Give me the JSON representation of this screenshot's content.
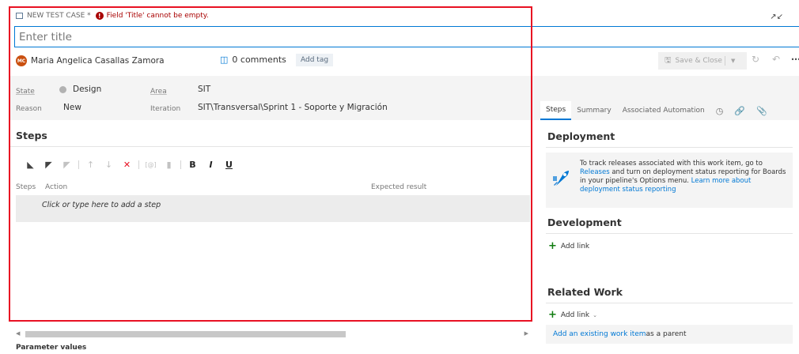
{
  "header": {
    "work_item_type": "NEW TEST CASE *",
    "error_message": "Field 'Title' cannot be empty."
  },
  "title": {
    "placeholder": "Enter title",
    "value": ""
  },
  "author": {
    "initials": "MC",
    "name": "Maria Angelica Casallas Zamora"
  },
  "comments": {
    "label": "0 comments"
  },
  "tags": {
    "add_label": "Add tag"
  },
  "actions": {
    "save_close": "Save & Close"
  },
  "fields": {
    "state_label": "State",
    "state_value": "Design",
    "reason_label": "Reason",
    "reason_value": "New",
    "area_label": "Area",
    "area_value": "SIT",
    "iteration_label": "Iteration",
    "iteration_value": "SIT\\Transversal\\Sprint 1 - Soporte y Migración"
  },
  "right_tabs": [
    {
      "label": "Steps",
      "active": true
    },
    {
      "label": "Summary",
      "active": false
    },
    {
      "label": "Associated Automation",
      "active": false
    }
  ],
  "steps": {
    "heading": "Steps",
    "columns": {
      "steps": "Steps",
      "action": "Action",
      "expected": "Expected result"
    },
    "add_step_placeholder": "Click or type here to add a step"
  },
  "parameters": {
    "heading": "Parameter values"
  },
  "deployment": {
    "title": "Deployment",
    "text_1": "To track releases associated with this work item, go to ",
    "link_releases": "Releases",
    "text_2": " and turn on deployment status reporting for Boards in your pipeline's Options menu. ",
    "link_learn_more": "Learn more about deployment status reporting"
  },
  "development": {
    "title": "Development",
    "add_link": "Add link"
  },
  "related_work": {
    "title": "Related Work",
    "add_link": "Add link",
    "existing_link": "Add an existing work item",
    "existing_suffix": " as a parent"
  },
  "colors": {
    "accent": "#0078d4",
    "error": "#e81123",
    "add_green": "#107c10",
    "avatar_bg": "#ca5010"
  }
}
